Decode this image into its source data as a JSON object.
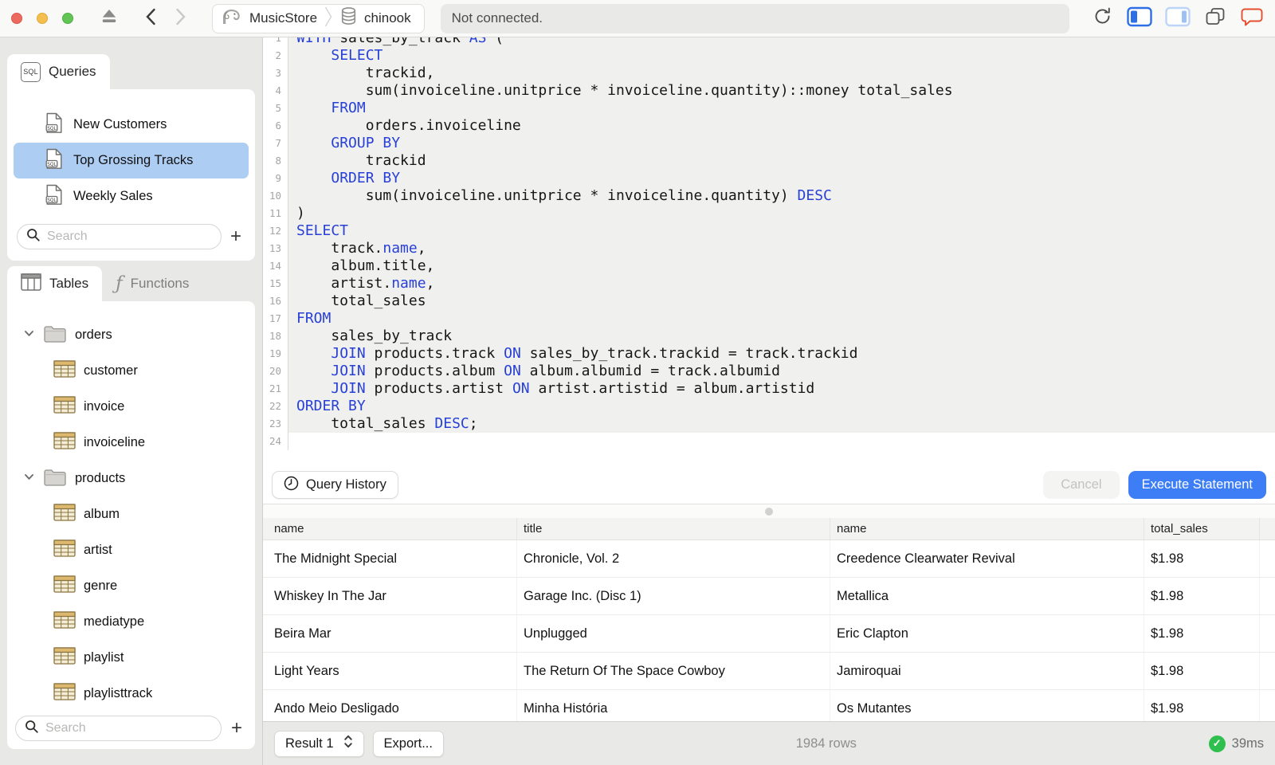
{
  "titlebar": {
    "breadcrumb": {
      "server": "MusicStore",
      "database": "chinook"
    },
    "status": "Not connected."
  },
  "sidebar": {
    "queries": {
      "tab_label": "Queries",
      "tab_icon": "SQL",
      "items": [
        {
          "label": "New Customers",
          "selected": false
        },
        {
          "label": "Top Grossing Tracks",
          "selected": true
        },
        {
          "label": "Weekly Sales",
          "selected": false
        }
      ],
      "search_placeholder": "Search",
      "add_label": "+"
    },
    "tables": {
      "tab_label": "Tables",
      "functions_tab_label": "Functions",
      "functions_icon": "ƒ",
      "tree": [
        {
          "kind": "folder",
          "label": "orders",
          "expanded": true
        },
        {
          "kind": "table",
          "label": "customer"
        },
        {
          "kind": "table",
          "label": "invoice"
        },
        {
          "kind": "table",
          "label": "invoiceline"
        },
        {
          "kind": "folder",
          "label": "products",
          "expanded": true
        },
        {
          "kind": "table",
          "label": "album"
        },
        {
          "kind": "table",
          "label": "artist"
        },
        {
          "kind": "table",
          "label": "genre"
        },
        {
          "kind": "table",
          "label": "mediatype"
        },
        {
          "kind": "table",
          "label": "playlist"
        },
        {
          "kind": "table",
          "label": "playlisttrack"
        }
      ],
      "search_placeholder": "Search",
      "add_label": "+"
    }
  },
  "editor": {
    "highlight_through_line": 23,
    "lines": [
      {
        "n": 1,
        "t": [
          [
            "k",
            "WITH"
          ],
          [
            "p",
            " sales_by_track "
          ],
          [
            "k",
            "AS"
          ],
          [
            "p",
            " ("
          ]
        ]
      },
      {
        "n": 2,
        "t": [
          [
            "p",
            "    "
          ],
          [
            "k",
            "SELECT"
          ]
        ]
      },
      {
        "n": 3,
        "t": [
          [
            "p",
            "        trackid,"
          ]
        ]
      },
      {
        "n": 4,
        "t": [
          [
            "p",
            "        sum(invoiceline.unitprice * invoiceline.quantity)::money total_sales"
          ]
        ]
      },
      {
        "n": 5,
        "t": [
          [
            "p",
            "    "
          ],
          [
            "k",
            "FROM"
          ]
        ]
      },
      {
        "n": 6,
        "t": [
          [
            "p",
            "        orders.invoiceline"
          ]
        ]
      },
      {
        "n": 7,
        "t": [
          [
            "p",
            "    "
          ],
          [
            "k",
            "GROUP BY"
          ]
        ]
      },
      {
        "n": 8,
        "t": [
          [
            "p",
            "        trackid"
          ]
        ]
      },
      {
        "n": 9,
        "t": [
          [
            "p",
            "    "
          ],
          [
            "k",
            "ORDER BY"
          ]
        ]
      },
      {
        "n": 10,
        "t": [
          [
            "p",
            "        sum(invoiceline.unitprice * invoiceline.quantity) "
          ],
          [
            "k",
            "DESC"
          ]
        ]
      },
      {
        "n": 11,
        "t": [
          [
            "p",
            ")"
          ]
        ]
      },
      {
        "n": 12,
        "t": [
          [
            "k",
            "SELECT"
          ]
        ]
      },
      {
        "n": 13,
        "t": [
          [
            "p",
            "    track."
          ],
          [
            "k",
            "name"
          ],
          [
            "p",
            ","
          ]
        ]
      },
      {
        "n": 14,
        "t": [
          [
            "p",
            "    album.title,"
          ]
        ]
      },
      {
        "n": 15,
        "t": [
          [
            "p",
            "    artist."
          ],
          [
            "k",
            "name"
          ],
          [
            "p",
            ","
          ]
        ]
      },
      {
        "n": 16,
        "t": [
          [
            "p",
            "    total_sales"
          ]
        ]
      },
      {
        "n": 17,
        "t": [
          [
            "k",
            "FROM"
          ]
        ]
      },
      {
        "n": 18,
        "t": [
          [
            "p",
            "    sales_by_track"
          ]
        ]
      },
      {
        "n": 19,
        "t": [
          [
            "p",
            "    "
          ],
          [
            "k",
            "JOIN"
          ],
          [
            "p",
            " products.track "
          ],
          [
            "k",
            "ON"
          ],
          [
            "p",
            " sales_by_track.trackid = track.trackid"
          ]
        ]
      },
      {
        "n": 20,
        "t": [
          [
            "p",
            "    "
          ],
          [
            "k",
            "JOIN"
          ],
          [
            "p",
            " products.album "
          ],
          [
            "k",
            "ON"
          ],
          [
            "p",
            " album.albumid = track.albumid"
          ]
        ]
      },
      {
        "n": 21,
        "t": [
          [
            "p",
            "    "
          ],
          [
            "k",
            "JOIN"
          ],
          [
            "p",
            " products.artist "
          ],
          [
            "k",
            "ON"
          ],
          [
            "p",
            " artist.artistid = album.artistid"
          ]
        ]
      },
      {
        "n": 22,
        "t": [
          [
            "k",
            "ORDER BY"
          ]
        ]
      },
      {
        "n": 23,
        "t": [
          [
            "p",
            "    total_sales "
          ],
          [
            "k",
            "DESC"
          ],
          [
            "p",
            ";"
          ]
        ]
      },
      {
        "n": 24,
        "t": []
      }
    ]
  },
  "toolbar": {
    "query_history_label": "Query History",
    "cancel_label": "Cancel",
    "execute_label": "Execute Statement"
  },
  "results": {
    "columns": [
      "name",
      "title",
      "name",
      "total_sales"
    ],
    "rows": [
      [
        "The Midnight Special",
        "Chronicle, Vol. 2",
        "Creedence Clearwater Revival",
        "$1.98"
      ],
      [
        "Whiskey In The Jar",
        "Garage Inc. (Disc 1)",
        "Metallica",
        "$1.98"
      ],
      [
        "Beira Mar",
        "Unplugged",
        "Eric Clapton",
        "$1.98"
      ],
      [
        "Light Years",
        "The Return Of The Space Cowboy",
        "Jamiroquai",
        "$1.98"
      ],
      [
        "Ando Meio Desligado",
        "Minha História",
        "Os Mutantes",
        "$1.98"
      ]
    ]
  },
  "statusbar": {
    "result_selector_label": "Result 1",
    "export_label": "Export...",
    "row_count": "1984 rows",
    "checkmark": "✓",
    "duration": "39ms"
  },
  "colors": {
    "accent_blue": "#3d7ef7",
    "selection_blue": "#aecdf3",
    "keyword_blue": "#2840d6",
    "success_green": "#2fbf4f",
    "table_icon_tan": "#dcb96e",
    "feedback_orange": "#e4502f"
  }
}
